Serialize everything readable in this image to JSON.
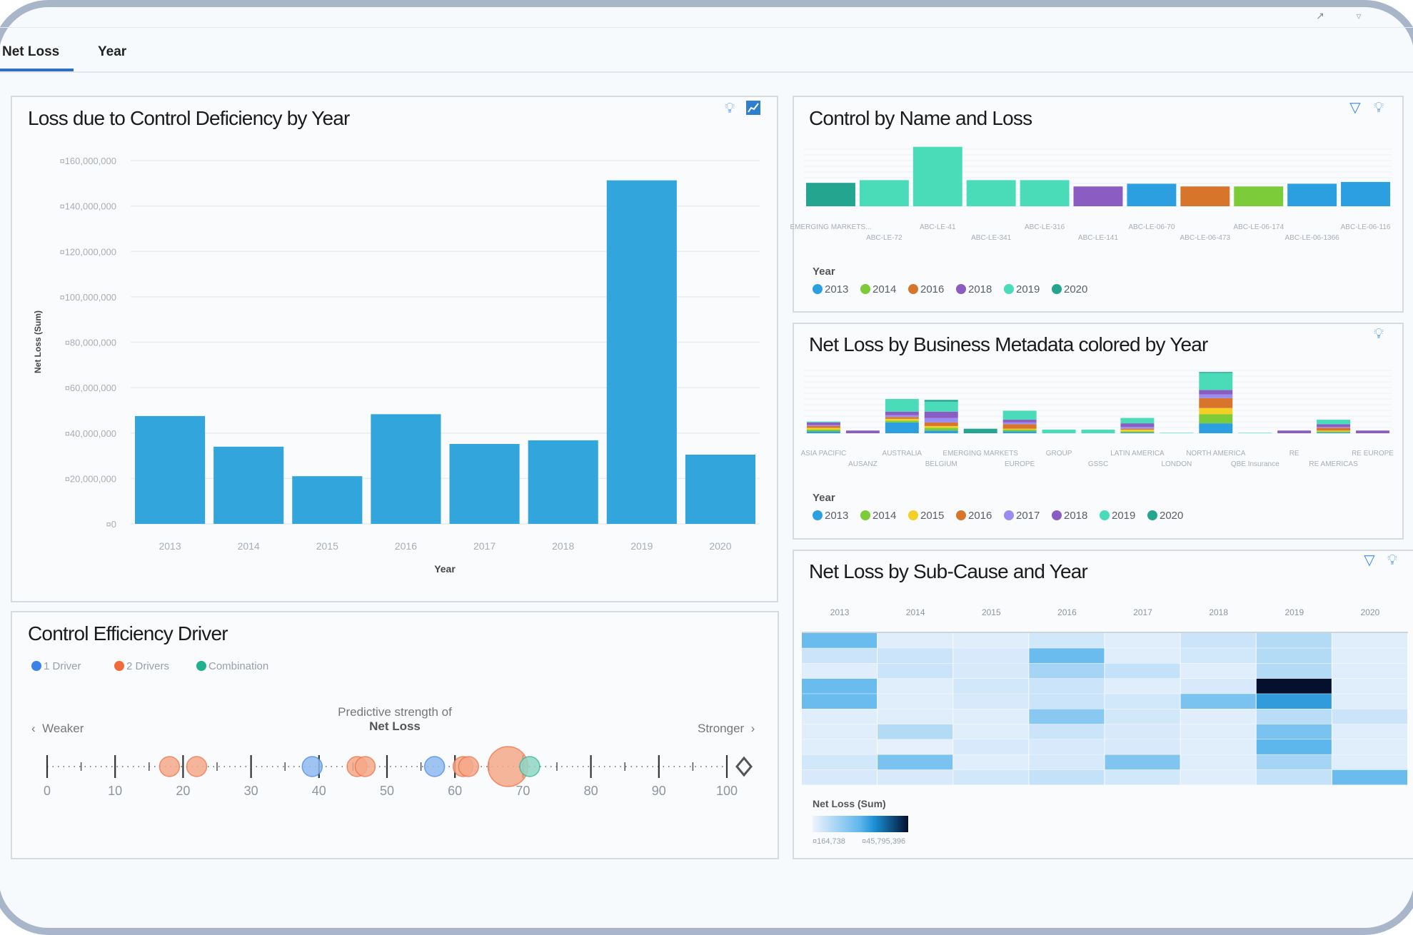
{
  "tabs": [
    {
      "label": "Net Loss",
      "active": true
    },
    {
      "label": "Year",
      "active": false
    }
  ],
  "colors": {
    "accent": "#2f6fbf",
    "bar": "#33a5dd",
    "years": {
      "2013": "#2c9fe0",
      "2014": "#7ccb39",
      "2015": "#f4cf26",
      "2016": "#d7752b",
      "2017": "#9b8cf2",
      "2018": "#8b5cc1",
      "2019": "#4adbb8",
      "2020": "#23a58f"
    },
    "drivers": {
      "1 Driver": "#3b82e8",
      "2 Drivers": "#f06a3a",
      "Combination": "#1fb08f"
    }
  },
  "panels": {
    "loss_by_year": {
      "title": "Loss due to Control Deficiency by Year",
      "icons": [
        "lightbulb-icon",
        "chart-icon"
      ]
    },
    "control_by_name": {
      "title": "Control by Name and Loss",
      "icons": [
        "filter-icon",
        "lightbulb-icon"
      ],
      "legend_title": "Year"
    },
    "business_metadata": {
      "title": "Net Loss by Business Metadata colored by Year",
      "icons": [
        "lightbulb-icon"
      ],
      "legend_title": "Year"
    },
    "sub_cause": {
      "title": "Net Loss by Sub-Cause and Year",
      "icons": [
        "filter-icon",
        "lightbulb-icon"
      ],
      "legend_title": "Net Loss (Sum)",
      "legend_min": "¤164,738",
      "legend_max": "¤45,795,396"
    },
    "driver": {
      "title": "Control Efficiency Driver",
      "weaker": "Weaker",
      "stronger": "Stronger",
      "axis_title_1": "Predictive strength of",
      "axis_title_2": "Net Loss"
    }
  },
  "chart_data": [
    {
      "type": "bar",
      "title": "Loss due to Control Deficiency by Year",
      "xlabel": "Year",
      "ylabel": "Net Loss (Sum)",
      "categories": [
        "2013",
        "2014",
        "2015",
        "2016",
        "2017",
        "2018",
        "2019",
        "2020"
      ],
      "values": [
        47500000,
        34000000,
        21000000,
        48300000,
        35200000,
        36800000,
        151300000,
        30500000
      ],
      "ylim": [
        0,
        160000000
      ],
      "yticks": [
        "¤0",
        "¤20,000,000",
        "¤40,000,000",
        "¤60,000,000",
        "¤80,000,000",
        "¤100,000,000",
        "¤120,000,000",
        "¤140,000,000",
        "¤160,000,000"
      ],
      "grid": true
    },
    {
      "type": "bar",
      "title": "Control by Name and Loss",
      "categories": [
        "EMERGING MARKETS...",
        "ABC-LE-72",
        "ABC-LE-41",
        "ABC-LE-341",
        "ABC-LE-316",
        "ABC-LE-141",
        "ABC-LE-06-70",
        "ABC-LE-06-473",
        "ABC-LE-06-174",
        "ABC-LE-06-1366",
        "ABC-LE-06-116"
      ],
      "values": [
        26,
        29,
        66,
        29,
        29,
        22,
        25,
        22,
        22,
        25,
        27
      ],
      "year": [
        "2020",
        "2019",
        "2019",
        "2019",
        "2019",
        "2018",
        "2013",
        "2016",
        "2014",
        "2013",
        "2013"
      ],
      "legend": [
        "2013",
        "2014",
        "2016",
        "2018",
        "2019",
        "2020"
      ],
      "legend_placement": "bottom-left",
      "grid": true
    },
    {
      "type": "bar",
      "stacked": true,
      "title": "Net Loss by Business Metadata colored by Year",
      "categories": [
        "ASIA PACIFIC",
        "AUSANZ",
        "AUSTRALIA",
        "BELGIUM",
        "EMERGING MARKETS",
        "EUROPE",
        "GROUP",
        "GSSC",
        "LATIN AMERICA",
        "LONDON",
        "NORTH AMERICA",
        "QBE Insurance",
        "RE",
        "RE AMERICAS",
        "RE EUROPE"
      ],
      "series": [
        {
          "name": "2013",
          "values": [
            2,
            0,
            12,
            3,
            0,
            2,
            0,
            0,
            1,
            0,
            11,
            0,
            0,
            1,
            0
          ]
        },
        {
          "name": "2014",
          "values": [
            2,
            0,
            2,
            3,
            0,
            2,
            0,
            0,
            1,
            0,
            10,
            0,
            0,
            1,
            0
          ]
        },
        {
          "name": "2015",
          "values": [
            2,
            0,
            2,
            2,
            0,
            1,
            0,
            0,
            2,
            0,
            7,
            0,
            0,
            1,
            0
          ]
        },
        {
          "name": "2016",
          "values": [
            2,
            0,
            2,
            4,
            0,
            5,
            0,
            0,
            1,
            0,
            11,
            0,
            0,
            3,
            0
          ]
        },
        {
          "name": "2017",
          "values": [
            1,
            0,
            2,
            5,
            0,
            2,
            0,
            0,
            2,
            0,
            4,
            0,
            0,
            1,
            0
          ]
        },
        {
          "name": "2018",
          "values": [
            3,
            3,
            4,
            7,
            0,
            3,
            0,
            0,
            4,
            0,
            5,
            0,
            3,
            3,
            3
          ]
        },
        {
          "name": "2019",
          "values": [
            1,
            0,
            14,
            11,
            0,
            10,
            4,
            4,
            6,
            0.5,
            19,
            0.5,
            0,
            5,
            0
          ]
        },
        {
          "name": "2020",
          "values": [
            0,
            0,
            0,
            2,
            5,
            0,
            0,
            0,
            0,
            0,
            1,
            0,
            0,
            0,
            0
          ]
        }
      ],
      "legend": [
        "2013",
        "2014",
        "2015",
        "2016",
        "2017",
        "2018",
        "2019",
        "2020"
      ],
      "legend_placement": "bottom-left",
      "grid": true
    },
    {
      "type": "heatmap",
      "title": "Net Loss by Sub-Cause and Year",
      "columns": [
        "2013",
        "2014",
        "2015",
        "2016",
        "2017",
        "2018",
        "2019",
        "2020"
      ],
      "values": [
        [
          20700000,
          2400000,
          2400000,
          4700000,
          2400000,
          5600000,
          9300000,
          2400000
        ],
        [
          5600000,
          5600000,
          3800000,
          20700000,
          2400000,
          4700000,
          9300000,
          2400000
        ],
        [
          2400000,
          5600000,
          3800000,
          11600000,
          7000000,
          2400000,
          9300000,
          2400000
        ],
        [
          20700000,
          2400000,
          4700000,
          5600000,
          2400000,
          3800000,
          45795396,
          2400000
        ],
        [
          20700000,
          2400000,
          3800000,
          5600000,
          4700000,
          18400000,
          27500000,
          2400000
        ],
        [
          2400000,
          2400000,
          2400000,
          16100000,
          4700000,
          2400000,
          8400000,
          5600000
        ],
        [
          2400000,
          9300000,
          2400000,
          5600000,
          3800000,
          2400000,
          18400000,
          2400000
        ],
        [
          2400000,
          1500000,
          3800000,
          3800000,
          3800000,
          2400000,
          23000000,
          2400000
        ],
        [
          4700000,
          18400000,
          2400000,
          3800000,
          17500000,
          2400000,
          11600000,
          2400000
        ],
        [
          3800000,
          3800000,
          4700000,
          7000000,
          4700000,
          2400000,
          7000000,
          20700000
        ]
      ],
      "color_range": [
        164738,
        45795396
      ],
      "legend_title": "Net Loss (Sum)"
    },
    {
      "type": "scatter",
      "title": "Control Efficiency Driver",
      "xlabel": "Predictive strength of Net Loss",
      "xlim": [
        0,
        100
      ],
      "xticks": [
        0,
        10,
        20,
        30,
        40,
        50,
        60,
        70,
        80,
        90,
        100
      ],
      "legend": [
        "1 Driver",
        "2 Drivers",
        "Combination"
      ],
      "legend_placement": "top-left",
      "points": [
        {
          "x": 18,
          "type": "2 Drivers",
          "size": 1
        },
        {
          "x": 22,
          "type": "2 Drivers",
          "size": 1
        },
        {
          "x": 39,
          "type": "1 Driver",
          "size": 1
        },
        {
          "x": 45.6,
          "type": "2 Drivers",
          "size": 1
        },
        {
          "x": 46.8,
          "type": "2 Drivers",
          "size": 1
        },
        {
          "x": 57,
          "type": "1 Driver",
          "size": 1
        },
        {
          "x": 61.2,
          "type": "2 Drivers",
          "size": 1
        },
        {
          "x": 62,
          "type": "2 Drivers",
          "size": 1
        },
        {
          "x": 67.8,
          "type": "2 Drivers",
          "size": 2
        },
        {
          "x": 71,
          "type": "Combination",
          "size": 1
        }
      ]
    }
  ]
}
